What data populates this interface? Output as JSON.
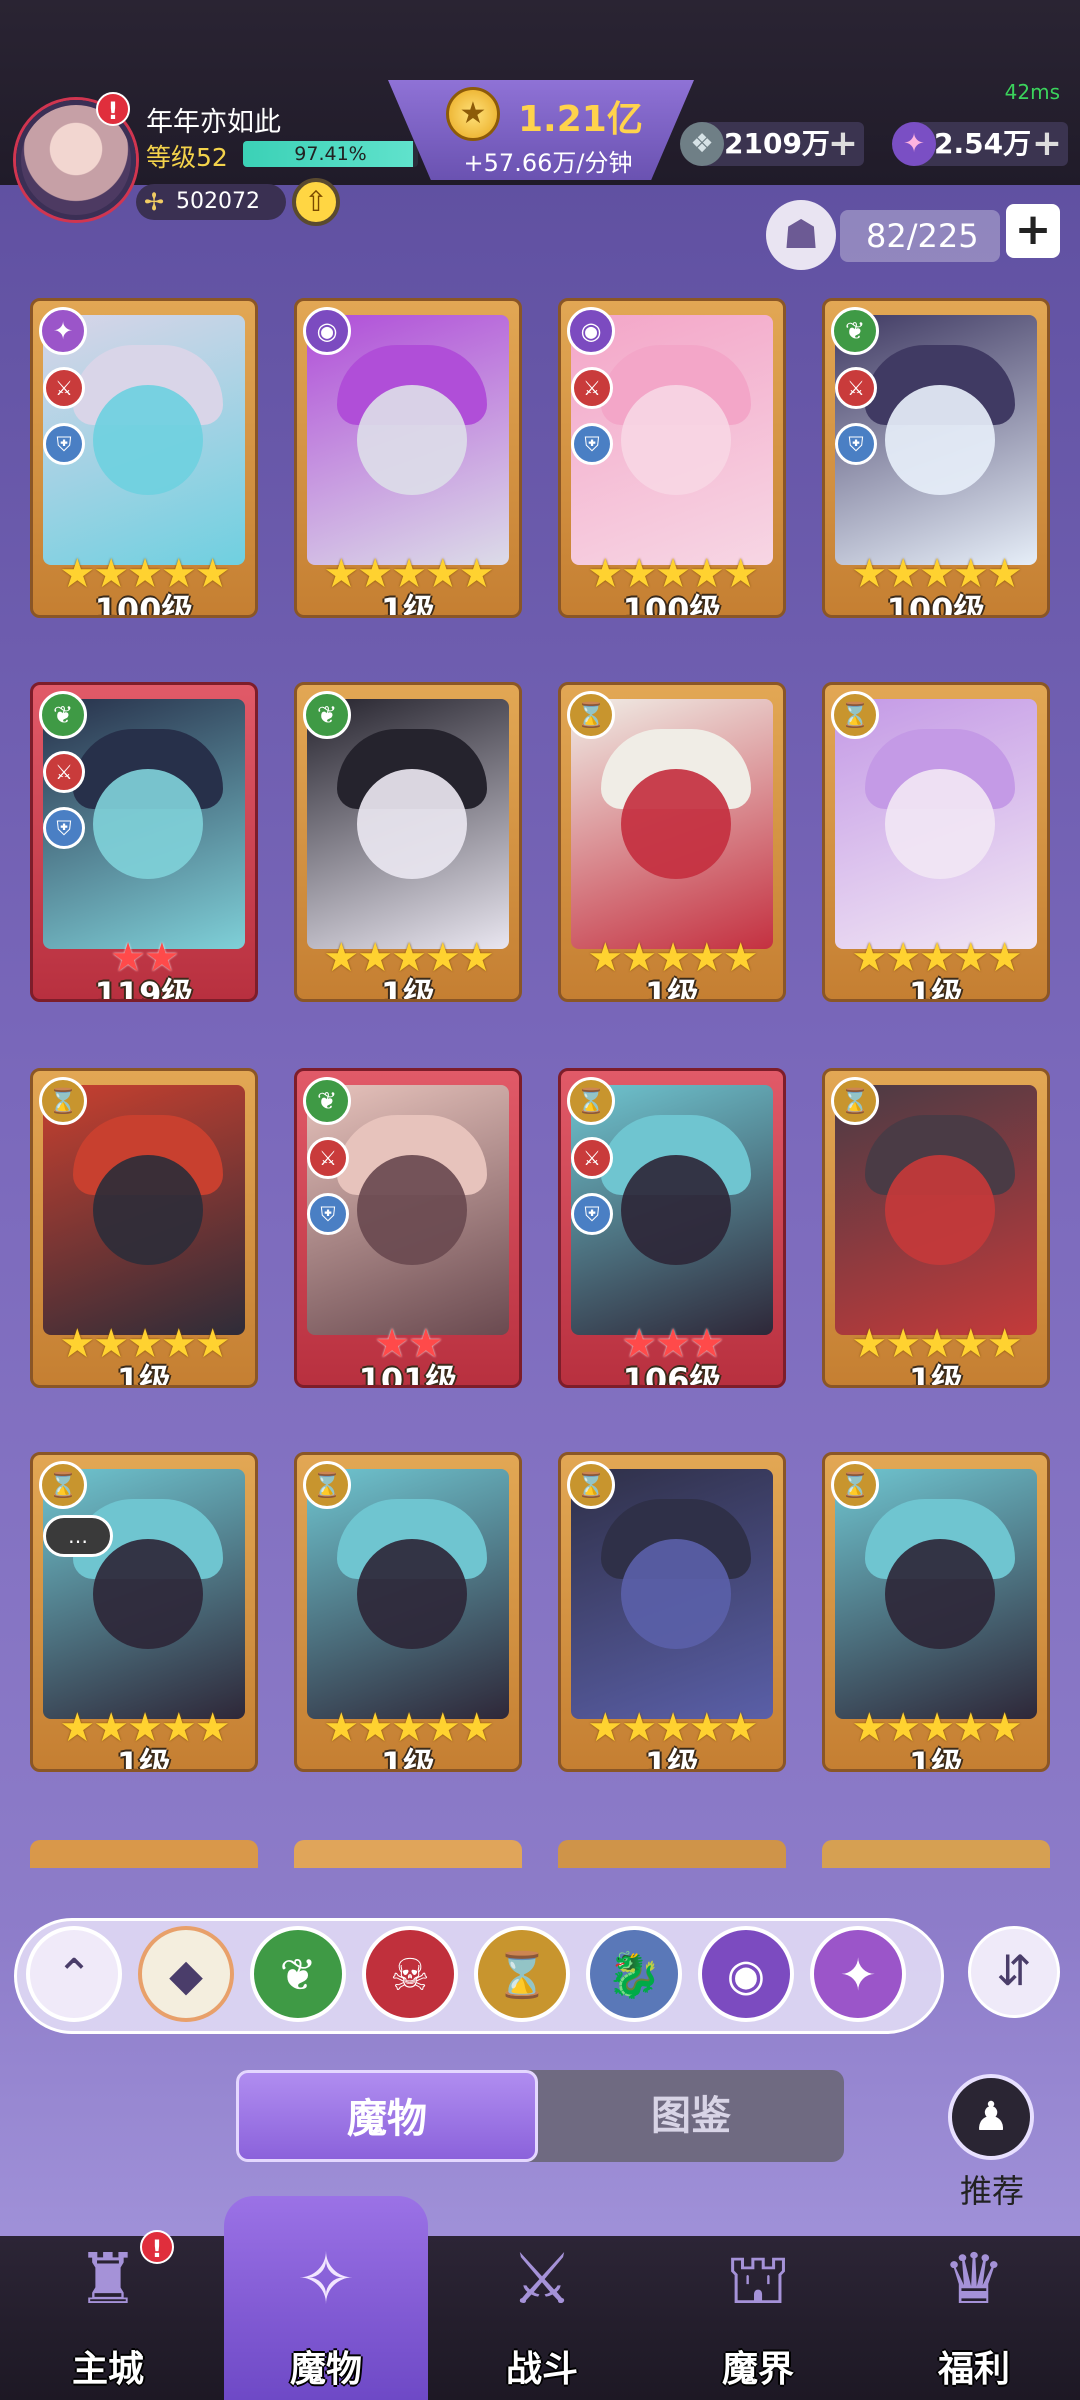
{
  "status": {
    "ping": "42ms"
  },
  "player": {
    "name": "年年亦如此",
    "level_label": "等级52",
    "xp_percent_text": "97.41%",
    "xp_fraction": 0.9741,
    "power": "502072"
  },
  "currency": {
    "gold": "1.21亿",
    "gold_rate": "+57.66万/分钟",
    "silver": "2109万",
    "gems": "2.54万"
  },
  "roster": {
    "count": "82/225"
  },
  "cards": [
    {
      "level": "100级",
      "stars": 5,
      "star_color": "gold",
      "frame": "gold",
      "element": "star",
      "element_color": "#9b55c9",
      "badges": [
        "sword",
        "shield"
      ],
      "art": [
        "#d9d5e8",
        "#6fd0e0"
      ]
    },
    {
      "level": "1级",
      "stars": 5,
      "star_color": "gold",
      "frame": "gold",
      "element": "eye",
      "element_color": "#7c4bc0",
      "badges": [],
      "art": [
        "#b04ed8",
        "#dcdce8"
      ]
    },
    {
      "level": "100级",
      "stars": 5,
      "star_color": "gold",
      "frame": "gold",
      "element": "eye",
      "element_color": "#7c4bc0",
      "badges": [
        "sword",
        "shield"
      ],
      "art": [
        "#f3a6c8",
        "#f7d6e4"
      ]
    },
    {
      "level": "100级",
      "stars": 5,
      "star_color": "gold",
      "frame": "gold",
      "element": "leaf",
      "element_color": "#3f9a45",
      "badges": [
        "sword",
        "shield"
      ],
      "art": [
        "#403a63",
        "#e6eef8"
      ]
    },
    {
      "level": "119级",
      "stars": 2,
      "star_color": "red",
      "frame": "red",
      "element": "leaf",
      "element_color": "#3f9a45",
      "badges": [
        "sword",
        "shield"
      ],
      "art": [
        "#27304a",
        "#7fd0d8"
      ]
    },
    {
      "level": "1级",
      "stars": 5,
      "star_color": "gold",
      "frame": "gold",
      "element": "leaf",
      "element_color": "#3f9a45",
      "badges": [],
      "art": [
        "#25232d",
        "#e9e6f0"
      ]
    },
    {
      "level": "1级",
      "stars": 5,
      "star_color": "gold",
      "frame": "gold",
      "element": "hourglass",
      "element_color": "#c8952e",
      "badges": [],
      "art": [
        "#f0ede6",
        "#c43040"
      ]
    },
    {
      "level": "1级",
      "stars": 5,
      "star_color": "gold",
      "frame": "gold",
      "element": "hourglass",
      "element_color": "#c8952e",
      "badges": [],
      "art": [
        "#c49ae6",
        "#f1e6f4"
      ]
    },
    {
      "level": "1级",
      "stars": 5,
      "star_color": "gold",
      "frame": "gold",
      "element": "hourglass",
      "element_color": "#c8952e",
      "badges": [],
      "art": [
        "#c8402f",
        "#2e2c38"
      ]
    },
    {
      "level": "101级",
      "stars": 2,
      "star_color": "red",
      "frame": "red",
      "element": "leaf",
      "element_color": "#3f9a45",
      "badges": [
        "sword",
        "shield"
      ],
      "art": [
        "#e7c3bc",
        "#6a4a50"
      ]
    },
    {
      "level": "106级",
      "stars": 3,
      "star_color": "red",
      "frame": "red",
      "element": "hourglass",
      "element_color": "#c8952e",
      "badges": [
        "sword",
        "shield"
      ],
      "art": [
        "#6fc5d0",
        "#2e2738"
      ]
    },
    {
      "level": "1级",
      "stars": 5,
      "star_color": "gold",
      "frame": "gold",
      "element": "hourglass",
      "element_color": "#c8952e",
      "badges": [],
      "art": [
        "#4a3b45",
        "#c43a3a"
      ]
    },
    {
      "level": "1级",
      "stars": 5,
      "star_color": "gold",
      "frame": "gold",
      "element": "hourglass",
      "element_color": "#c8952e",
      "badges": [
        "chat"
      ],
      "art": [
        "#6fc5d0",
        "#2e2738"
      ]
    },
    {
      "level": "1级",
      "stars": 5,
      "star_color": "gold",
      "frame": "gold",
      "element": "hourglass",
      "element_color": "#c8952e",
      "badges": [],
      "art": [
        "#6fc5d0",
        "#2e2738"
      ]
    },
    {
      "level": "1级",
      "stars": 5,
      "star_color": "gold",
      "frame": "gold",
      "element": "hourglass",
      "element_color": "#c8952e",
      "badges": [],
      "art": [
        "#2f3048",
        "#5a5fa8"
      ]
    },
    {
      "level": "1级",
      "stars": 5,
      "star_color": "gold",
      "frame": "gold",
      "element": "hourglass",
      "element_color": "#c8952e",
      "badges": [],
      "art": [
        "#6fc5d0",
        "#2e2738"
      ]
    }
  ],
  "filters": [
    {
      "name": "collapse",
      "icon": "⌃",
      "color": "#f0eaf9"
    },
    {
      "name": "all",
      "icon": "◆",
      "color": "#f4eede"
    },
    {
      "name": "leaf",
      "icon": "❦",
      "color": "#3f9a45"
    },
    {
      "name": "demon",
      "icon": "☠",
      "color": "#c0303c"
    },
    {
      "name": "hourglass",
      "icon": "⌛",
      "color": "#c8952e"
    },
    {
      "name": "dragon",
      "icon": "🐉",
      "color": "#5a78b8"
    },
    {
      "name": "eye",
      "icon": "◉",
      "color": "#7c4bc0"
    },
    {
      "name": "star",
      "icon": "✦",
      "color": "#9b55c9"
    }
  ],
  "tabs": {
    "monsters": "魔物",
    "codex": "图鉴"
  },
  "recommend": {
    "label": "推荐"
  },
  "nav": [
    {
      "id": "main-city",
      "label": "主城",
      "icon": "♜"
    },
    {
      "id": "monsters",
      "label": "魔物",
      "icon": "✧"
    },
    {
      "id": "battle",
      "label": "战斗",
      "icon": "⚔"
    },
    {
      "id": "demon-realm",
      "label": "魔界",
      "icon": "⛫"
    },
    {
      "id": "welfare",
      "label": "福利",
      "icon": "♛"
    }
  ]
}
